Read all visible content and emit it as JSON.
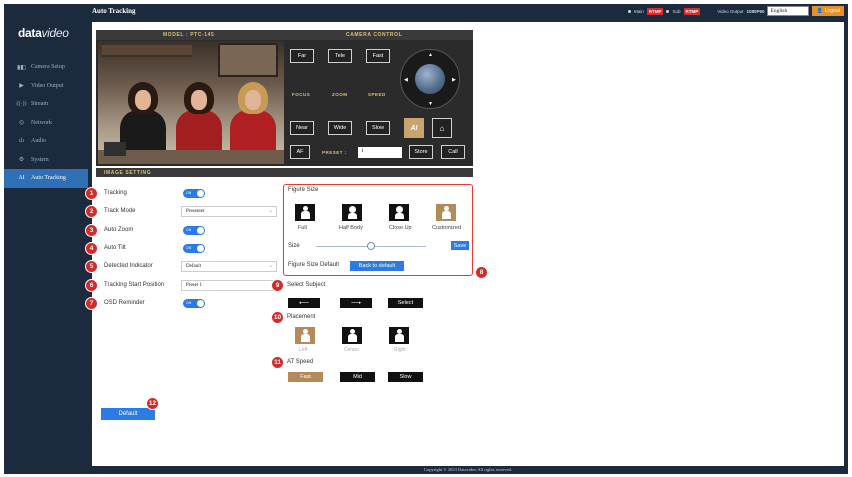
{
  "brand": {
    "logo_main": "data",
    "logo_accent": "video"
  },
  "sidebar": {
    "items": [
      {
        "icon": "camera-setup-icon",
        "glyph": "▮◧",
        "label": "Camera Setup",
        "active": false
      },
      {
        "icon": "video-output-icon",
        "glyph": "▶",
        "label": "Video Output",
        "active": false
      },
      {
        "icon": "stream-icon",
        "glyph": "((·))",
        "label": "Stream",
        "active": false
      },
      {
        "icon": "network-icon",
        "glyph": "◎",
        "label": "Network",
        "active": false
      },
      {
        "icon": "audio-icon",
        "glyph": "ılı",
        "label": "Audio",
        "active": false
      },
      {
        "icon": "system-icon",
        "glyph": "⚙",
        "label": "System",
        "active": false
      },
      {
        "icon": "auto-tracking-icon",
        "glyph": "AI",
        "label": "Auto Tracking",
        "active": true
      }
    ]
  },
  "header": {
    "title": "Auto Tracking",
    "main_label": "Main",
    "main_status": "RTMP",
    "sub_label": "Sub",
    "sub_status": "RTMP",
    "video_output_label": "Video Output",
    "video_output_value": "1080P60",
    "language": "English",
    "logout": "Logout"
  },
  "camera_panel": {
    "model_label": "MODEL : PTC-145",
    "control_label": "CAMERA CONTROL",
    "buttons": {
      "far": "Far",
      "tele": "Tele",
      "fast": "Fast",
      "near": "Near",
      "wide": "Wide",
      "slow": "Slow",
      "af": "AF",
      "store": "Store",
      "call": "Call"
    },
    "labels": {
      "focus": "FOCUS",
      "zoom": "ZOOM",
      "speed": "SPEED",
      "preset": "PRESET :"
    },
    "preset_value": "1",
    "ai_label": "AI"
  },
  "image_setting": {
    "label": "IMAGE SETTING"
  },
  "settings": {
    "tracking": {
      "num": "1",
      "label": "Tracking",
      "toggle": "ON"
    },
    "track_mode": {
      "num": "2",
      "label": "Track Mode",
      "value": "Presenter"
    },
    "auto_zoom": {
      "num": "3",
      "label": "Auto Zoom",
      "toggle": "ON"
    },
    "auto_tilt": {
      "num": "4",
      "label": "Auto Tilt",
      "toggle": "ON"
    },
    "detected_indicator": {
      "num": "5",
      "label": "Detected Indicator",
      "value": "Default"
    },
    "tracking_start": {
      "num": "6",
      "label": "Tracking Start Position",
      "value": "Preset 1"
    },
    "osd_reminder": {
      "num": "7",
      "label": "OSD Reminder",
      "toggle": "ON"
    }
  },
  "figure_size": {
    "title": "Figure Size",
    "options": [
      "Full",
      "Half Body",
      "Close Up",
      "Customized"
    ],
    "size_label": "Size",
    "size_fraction": 0.5,
    "save": "Save",
    "default_label": "Figure Size Default",
    "back_button": "Back to default",
    "badge": "8"
  },
  "select_subject": {
    "badge": "9",
    "title": "Select Subject",
    "prev": "⟵",
    "next": "⟶",
    "select": "Select"
  },
  "placement": {
    "badge": "10",
    "title": "Placement",
    "options": [
      "Left",
      "Center",
      "Right"
    ],
    "selected": "Left"
  },
  "at_speed": {
    "badge": "11",
    "title": "AT Speed",
    "options": [
      "Fast",
      "Mid",
      "Slow"
    ],
    "selected": "Fast"
  },
  "default_button": {
    "label": "Default",
    "badge": "12"
  },
  "footer": {
    "copyright": "Copyright © 2023 Datavideo All rights reserved."
  }
}
